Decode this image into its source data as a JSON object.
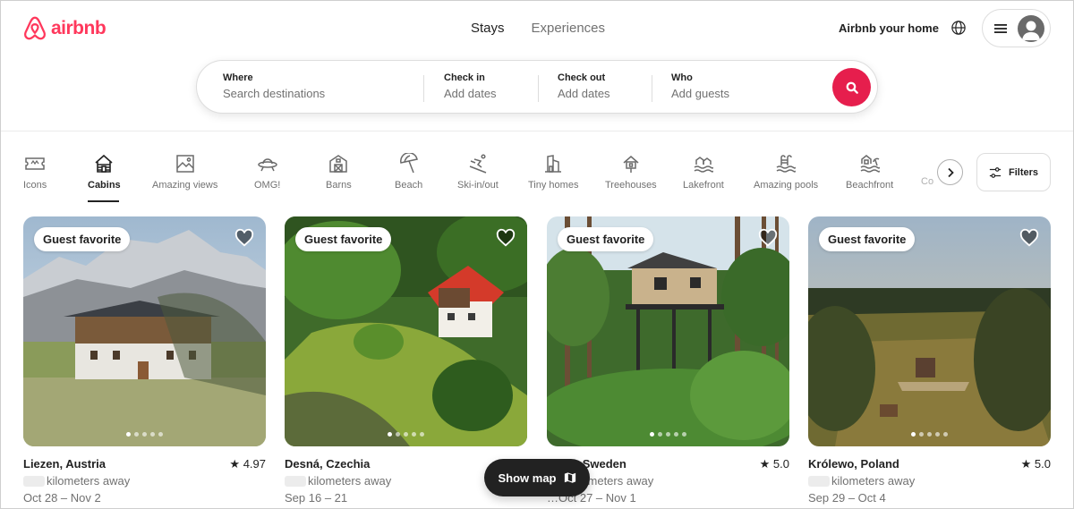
{
  "header": {
    "logo_text": "airbnb",
    "brand_color": "#FF385C",
    "tabs": [
      {
        "label": "Stays",
        "active": true
      },
      {
        "label": "Experiences",
        "active": false
      }
    ],
    "host_link": "Airbnb your home",
    "globe_icon": "globe-icon",
    "menu_icon": "hamburger-icon",
    "avatar_icon": "user-avatar-icon"
  },
  "search": {
    "where": {
      "label": "Where",
      "placeholder": "Search destinations"
    },
    "check_in": {
      "label": "Check in",
      "placeholder": "Add dates"
    },
    "check_out": {
      "label": "Check out",
      "placeholder": "Add dates"
    },
    "who": {
      "label": "Who",
      "placeholder": "Add guests"
    },
    "button_color": "#E61E4D",
    "button_icon": "search-icon"
  },
  "categories": {
    "selected": "Cabins",
    "items": [
      {
        "label": "Icons",
        "icon": "ticket-icon"
      },
      {
        "label": "Cabins",
        "icon": "cabin-icon"
      },
      {
        "label": "Amazing views",
        "icon": "view-icon"
      },
      {
        "label": "OMG!",
        "icon": "ufo-icon"
      },
      {
        "label": "Barns",
        "icon": "barn-icon"
      },
      {
        "label": "Beach",
        "icon": "umbrella-icon"
      },
      {
        "label": "Ski-in/out",
        "icon": "skier-icon"
      },
      {
        "label": "Tiny homes",
        "icon": "tiny-home-icon"
      },
      {
        "label": "Treehouses",
        "icon": "treehouse-icon"
      },
      {
        "label": "Lakefront",
        "icon": "lakefront-icon"
      },
      {
        "label": "Amazing pools",
        "icon": "pool-icon"
      },
      {
        "label": "Beachfront",
        "icon": "beachfront-icon"
      }
    ],
    "overflow_label": "Co",
    "next_icon": "chevron-right-icon",
    "filters_label": "Filters",
    "filters_icon": "sliders-icon"
  },
  "listings": [
    {
      "badge": "Guest favorite",
      "location": "Liezen, Austria",
      "rating": "★ 4.97",
      "distance": "kilometers away",
      "dates": "Oct 28 – Nov 2",
      "photo_count": 5,
      "active_photo": 0
    },
    {
      "badge": "Guest favorite",
      "location": "Desná, Czechia",
      "rating": "",
      "distance": "kilometers away",
      "dates": "Sep 16 – 21",
      "photo_count": 5,
      "active_photo": 0
    },
    {
      "badge": "Guest favorite",
      "location": "…mo, Sweden",
      "rating": "★ 5.0",
      "distance": "kilometers away",
      "dates": "…Oct 27 – Nov 1",
      "photo_count": 5,
      "active_photo": 0
    },
    {
      "badge": "Guest favorite",
      "location": "Królewo, Poland",
      "rating": "★ 5.0",
      "distance": "kilometers away",
      "dates": "Sep 29 – Oct 4",
      "photo_count": 5,
      "active_photo": 0
    }
  ],
  "show_map": {
    "label": "Show map",
    "icon": "map-icon"
  }
}
